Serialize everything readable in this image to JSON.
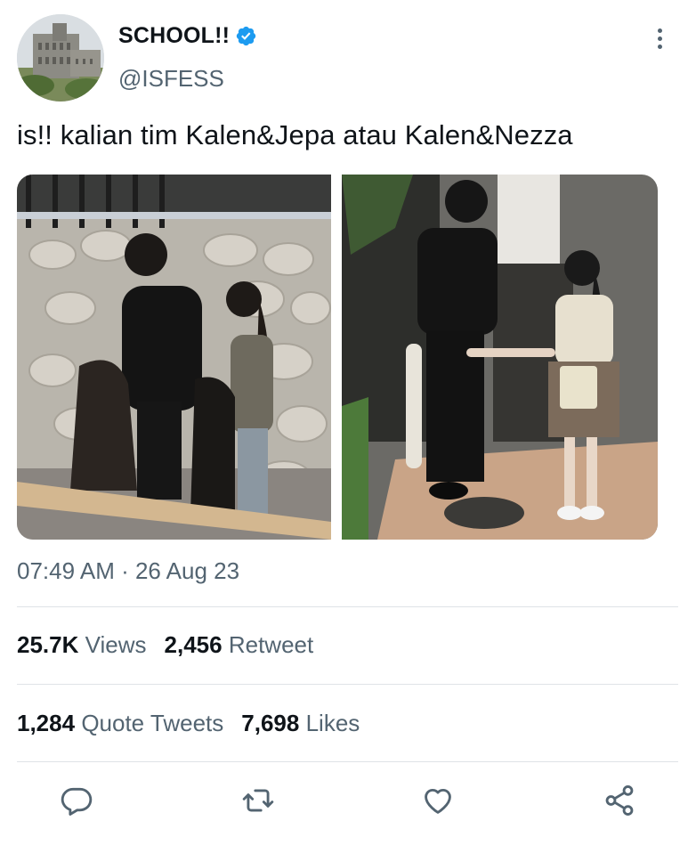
{
  "tweet": {
    "display_name": "SCHOOL!!",
    "handle": "@ISFESS",
    "text": "is!! kalian tim Kalen&Jepa atau Kalen&Nezza",
    "timestamp": "07:49 AM · 26 Aug 23",
    "verified_color": "#1d9bf0"
  },
  "stats": {
    "views_count": "25.7K",
    "views_label": "Views",
    "retweet_count": "2,456",
    "retweet_label": "Retweet",
    "quote_count": "1,284",
    "quote_label": "Quote Tweets",
    "likes_count": "7,698",
    "likes_label": "Likes"
  },
  "icons": {
    "avatar": "building-photo",
    "verified": "verified-badge-icon",
    "more": "more-vertical-icon",
    "reply": "reply-icon",
    "retweet": "retweet-icon",
    "like": "heart-icon",
    "share": "share-icon"
  },
  "colors": {
    "secondary_text": "#536471",
    "primary_text": "#0f1419",
    "accent": "#1d9bf0"
  }
}
